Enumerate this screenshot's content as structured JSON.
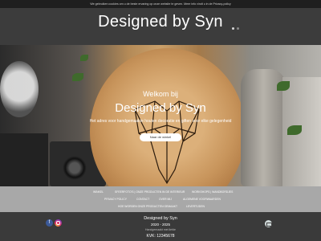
{
  "cookie_bar": {
    "text": "We gebruiken cookies om u de beste ervaring op onze website te geven. Meer info vindt u in de Privacy-policy"
  },
  "header": {
    "title": "Designed by Syn"
  },
  "slider": {
    "active_dot": 1,
    "dot_count": 2
  },
  "hero": {
    "welcome": "Welkom bij",
    "title": "Designed by Syn",
    "subtitle": "Het adres voor handgemaakte houten decoratie en giften voor elke gelegenheid",
    "cta_label": "Naar de winkel"
  },
  "nav": {
    "items": [
      "WINKEL",
      "SFEERFOTO'S | ONZE PRODUCTEN IN DE INTERIEUR",
      "WORKSHOPS | WANDBORDJES",
      "PRIVACY POLICY",
      "CONTACT",
      "OVER MIJ",
      "ALGEMENE VOORWAARDEN",
      "HOE WORDEN ONZE PRODUCTEN GEMAAKT",
      "LEVERTIJDEN"
    ]
  },
  "footer": {
    "name": "Designed by Syn",
    "years": "2020 - 2025",
    "note": "Handgemaakt met liefde",
    "kvk": "KVK: 12345678",
    "social_icons": [
      "facebook-icon",
      "instagram-icon"
    ],
    "mail_icon": "mail-icon"
  },
  "colors": {
    "header_bg": "#3c3c3c",
    "nav_bg": "#a8a8a8",
    "footer_bg": "#3a3a3a",
    "cookie_bg": "#1f1f1f"
  }
}
